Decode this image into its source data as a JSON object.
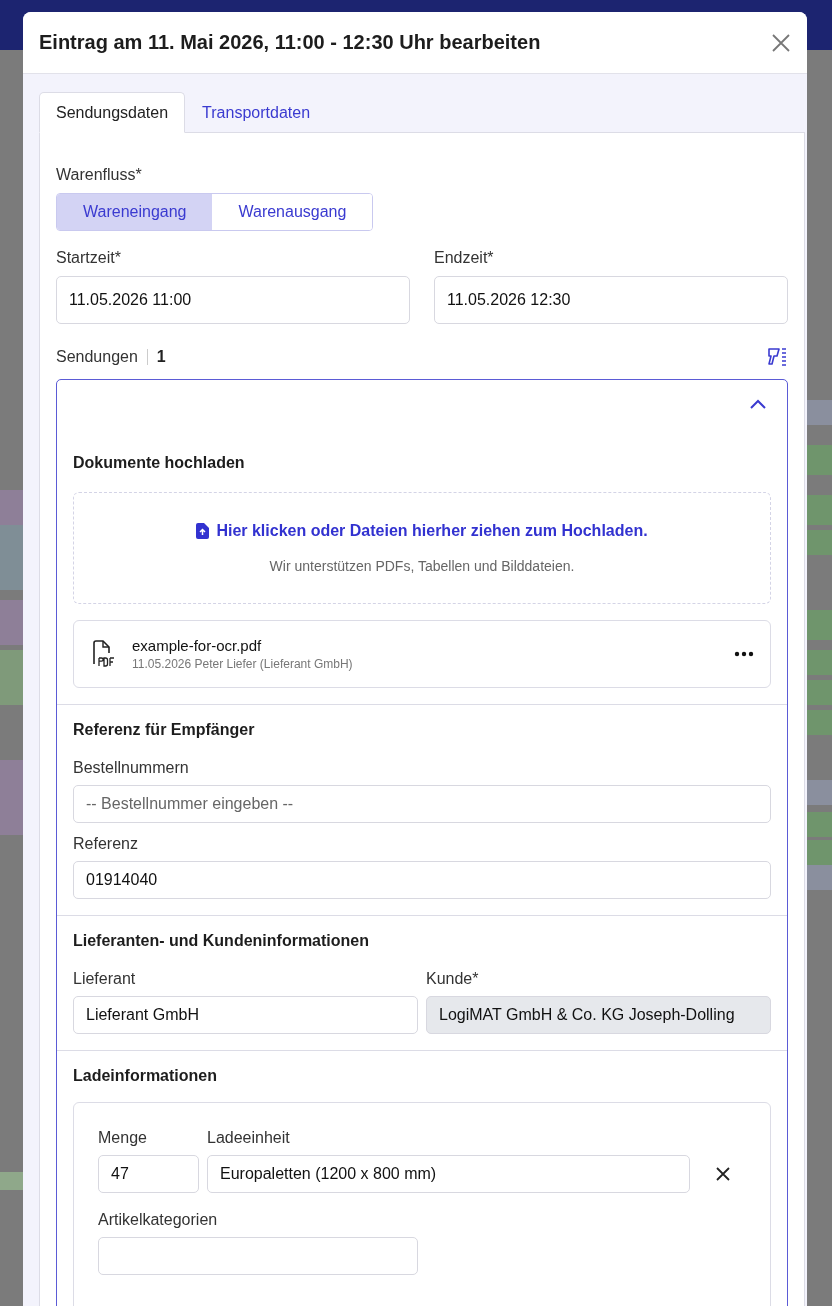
{
  "dialog": {
    "title": "Eintrag am 11. Mai 2026, 11:00 - 12:30 Uhr bearbeiten"
  },
  "tabs": [
    {
      "label": "Sendungsdaten",
      "selected": true
    },
    {
      "label": "Transportdaten",
      "selected": false
    }
  ],
  "warenfluss": {
    "label": "Warenfluss*",
    "options": [
      {
        "label": "Wareneingang",
        "selected": true
      },
      {
        "label": "Warenausgang",
        "selected": false
      }
    ]
  },
  "times": [
    {
      "label": "Startzeit*",
      "value": "11.05.2026 11:00"
    },
    {
      "label": "Endzeit*",
      "value": "11.05.2026 12:30"
    }
  ],
  "shipments": {
    "label": "Sendungen",
    "count": "1",
    "expanded": true,
    "upload": {
      "heading": "Dokumente hochladen",
      "link": "Hier klicken oder Dateien hierher ziehen zum Hochladen.",
      "hint": "Wir unterstützen PDFs, Tabellen und Bilddateien.",
      "files": [
        {
          "name": "example-for-ocr.pdf",
          "meta": "11.05.2026 Peter Liefer (Lieferant GmbH)"
        }
      ]
    },
    "reference": {
      "heading": "Referenz für Empfänger",
      "fields": [
        {
          "label": "Bestellnummern",
          "placeholder": "-- Bestellnummer eingeben --"
        },
        {
          "label": "Referenz",
          "value": "01914040"
        }
      ]
    },
    "parties": {
      "heading": "Lieferanten- und Kundeninformationen",
      "fields": [
        {
          "label": "Lieferant",
          "value": "Lieferant GmbH",
          "disabled": false
        },
        {
          "label": "Kunde*",
          "value": "LogiMAT GmbH & Co. KG Joseph-Dolling",
          "disabled": true
        }
      ]
    },
    "loading": {
      "heading": "Ladeinformationen",
      "items": [
        {
          "quantity_label": "Menge",
          "quantity": "47",
          "unit_label": "Ladeeinheit",
          "unit": "Europaletten (1200 x 800 mm)",
          "categories_label": "Artikelkategorien"
        }
      ]
    }
  }
}
